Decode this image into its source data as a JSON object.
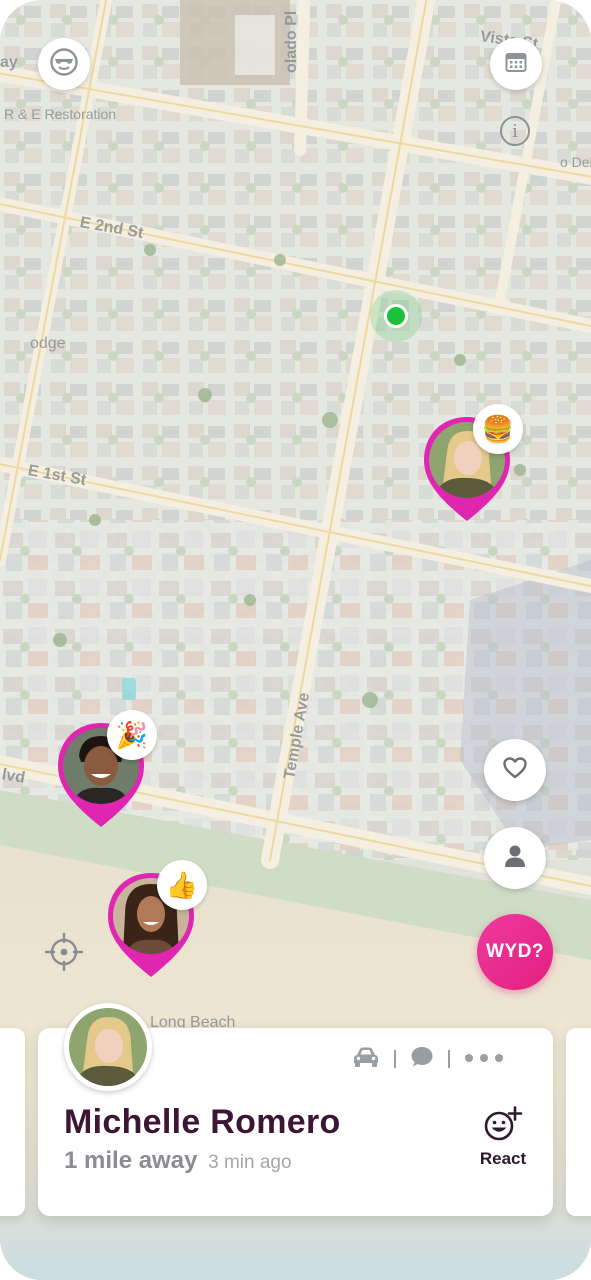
{
  "map": {
    "streets": [
      {
        "id": "e-2nd-st",
        "label": "E 2nd St"
      },
      {
        "id": "e-1st-st",
        "label": "E 1st St"
      },
      {
        "id": "temple-ave",
        "label": "Temple Ave"
      },
      {
        "id": "olado-pl",
        "label": "olado Pl"
      },
      {
        "id": "vista-st",
        "label": "Vista St"
      },
      {
        "id": "restoration",
        "label": "R & E Restoration"
      },
      {
        "id": "long-beach",
        "label": "Long Beach"
      },
      {
        "id": "blvd",
        "label": "lvd"
      },
      {
        "id": "way",
        "label": "ay"
      },
      {
        "id": "odge",
        "label": "odge"
      },
      {
        "id": "o-del",
        "label": "o Del"
      }
    ]
  },
  "top_controls": {
    "profile_icon": "sunglasses-face-icon",
    "calendar_icon": "calendar-icon",
    "info_icon": "info-icon",
    "info_glyph": "i"
  },
  "pins": [
    {
      "id": "pin-burger",
      "emoji": "🍔"
    },
    {
      "id": "pin-party",
      "emoji": "🎉"
    },
    {
      "id": "pin-thumbs",
      "emoji": "👍"
    }
  ],
  "side_controls": {
    "favorites_icon": "heart-icon",
    "friends_icon": "person-icon",
    "wyd_label": "WYD?",
    "locate_icon": "crosshair-icon"
  },
  "card": {
    "name": "Michelle Romero",
    "distance": "1 mile away",
    "time_ago": "3 min ago",
    "react_label": "React",
    "actions": [
      "car-icon",
      "chat-bubble-icon",
      "more-dots-icon"
    ]
  },
  "colors": {
    "accent": "#e0207f",
    "name_text": "#3d1535",
    "me_dot": "#1cc13b"
  }
}
